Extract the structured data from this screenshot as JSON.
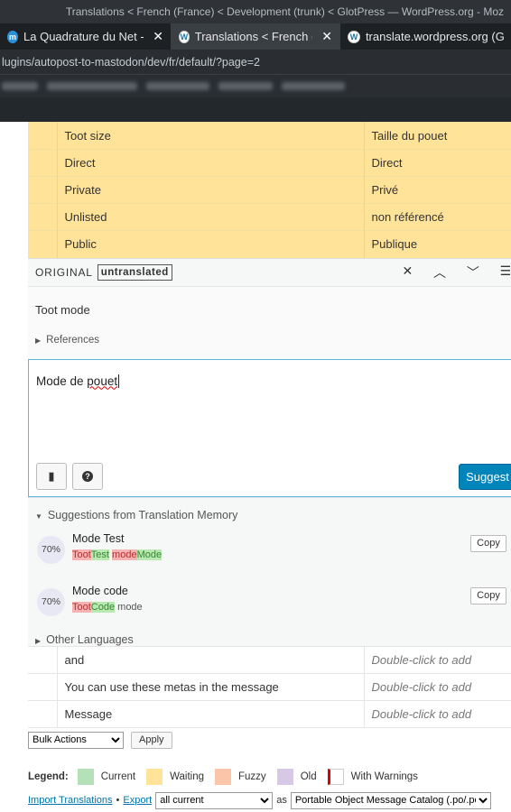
{
  "browser": {
    "window_title": "Translations < French (France) < Development (trunk) < GlotPress — WordPress.org - Moz",
    "tabs": [
      {
        "title": "La Quadrature du Net - Ma",
        "favicon": "mastodon-icon",
        "active": false
      },
      {
        "title": "Translations < French (Fran",
        "favicon": "wordpress-icon",
        "active": true
      },
      {
        "title": "translate.wordpress.org (G",
        "favicon": "wordpress-icon",
        "active": false
      }
    ],
    "url": "lugins/autopost-to-mastodon/dev/fr/default/?page=2"
  },
  "rows_top": [
    {
      "original": "Toot size",
      "translation": "Taille du pouet",
      "status": "waiting"
    },
    {
      "original": "Direct",
      "translation": "Direct",
      "status": "waiting"
    },
    {
      "original": "Private",
      "translation": "Privé",
      "status": "waiting"
    },
    {
      "original": "Unlisted",
      "translation": "non référencé",
      "status": "waiting"
    },
    {
      "original": "Public",
      "translation": "Publique",
      "status": "waiting"
    }
  ],
  "editor": {
    "original_label": "ORIGINAL",
    "status_badge": "untranslated",
    "original_text": "Toot mode",
    "references_label": "References",
    "translation_prefix": "Mode de ",
    "translation_misspelled": "pouet",
    "suggest_label": "Suggest",
    "suggestions_title": "Suggestions from Translation Memory",
    "suggestions": [
      {
        "percent": "70%",
        "text": "Mode Test",
        "diff": [
          {
            "t": "Toot",
            "k": "del"
          },
          {
            "t": "Test",
            "k": "ins"
          },
          {
            "t": " ",
            "k": "eq"
          },
          {
            "t": "mode",
            "k": "del"
          },
          {
            "t": "Mode",
            "k": "ins"
          }
        ]
      },
      {
        "percent": "70%",
        "text": "Mode code",
        "diff": [
          {
            "t": "Toot",
            "k": "del"
          },
          {
            "t": "Code",
            "k": "ins"
          },
          {
            "t": " mode",
            "k": "eq"
          }
        ]
      }
    ],
    "copy_label": "Copy",
    "other_languages_label": "Other Languages"
  },
  "rows_bottom": [
    {
      "original": "and",
      "translation": "Double-click to add"
    },
    {
      "original": "You can use these metas in the message",
      "translation": "Double-click to add"
    },
    {
      "original": "Message",
      "translation": "Double-click to add"
    }
  ],
  "bulk": {
    "select_value": "Bulk Actions",
    "apply_label": "Apply"
  },
  "legend": {
    "title": "Legend:",
    "items": [
      {
        "label": "Current",
        "color": "#b5e1b9"
      },
      {
        "label": "Waiting",
        "color": "#ffe399"
      },
      {
        "label": "Fuzzy",
        "color": "#fbc5a9"
      },
      {
        "label": "Old",
        "color": "#d7c8e6"
      },
      {
        "label": "With Warnings",
        "color": "#ffffff"
      }
    ]
  },
  "export": {
    "import_label": "Import Translations",
    "separator": "•",
    "export_label": "Export",
    "filter_value": "all current",
    "as_label": "as",
    "format_value": "Portable Object Message Catalog (.po/.pot)"
  }
}
